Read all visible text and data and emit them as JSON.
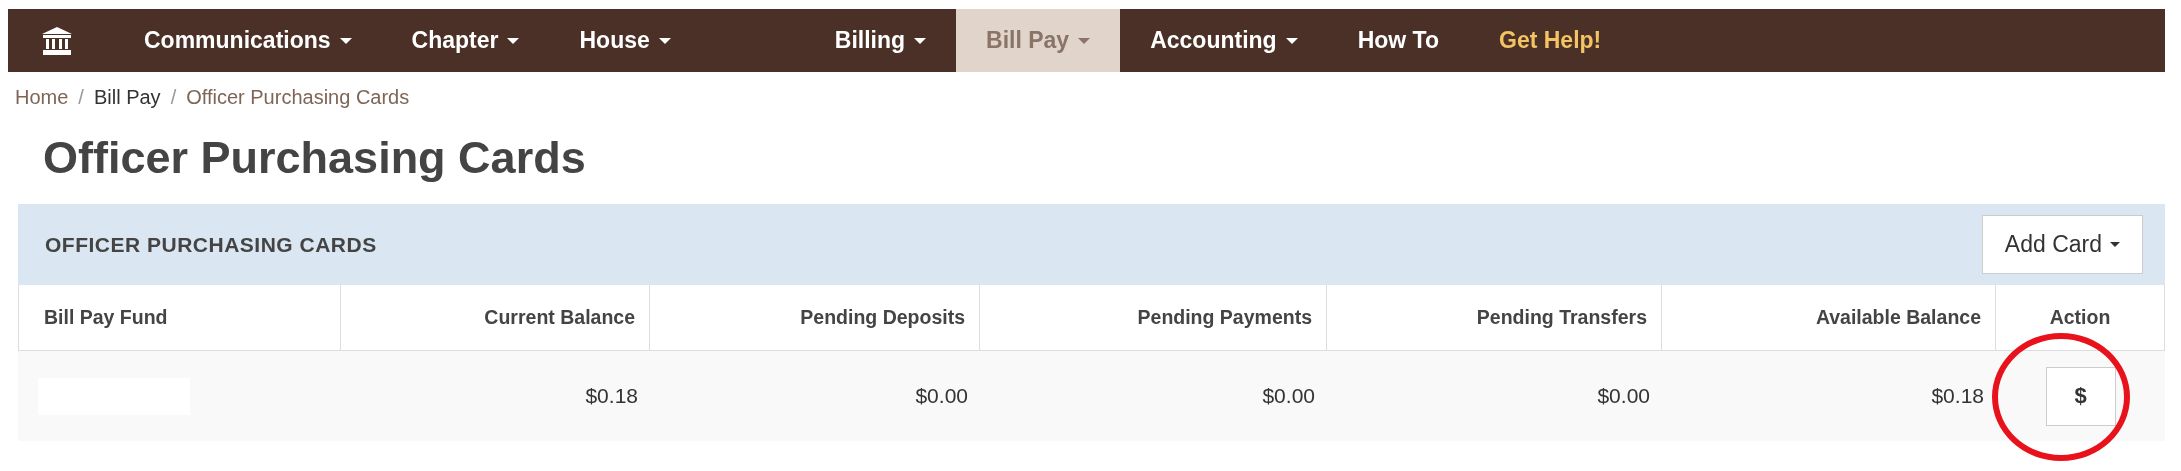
{
  "nav": {
    "items": [
      {
        "kind": "home",
        "dropdown": false,
        "selected": false
      },
      {
        "kind": "link",
        "label": "Communications",
        "dropdown": true,
        "selected": false
      },
      {
        "kind": "link",
        "label": "Chapter",
        "dropdown": true,
        "selected": false
      },
      {
        "kind": "link",
        "label": "House",
        "dropdown": true,
        "selected": false
      },
      {
        "kind": "link",
        "label": "Billing",
        "dropdown": true,
        "selected": false
      },
      {
        "kind": "link",
        "label": "Bill Pay",
        "dropdown": true,
        "selected": true
      },
      {
        "kind": "link",
        "label": "Accounting",
        "dropdown": true,
        "selected": false
      },
      {
        "kind": "link",
        "label": "How To",
        "dropdown": false,
        "selected": false
      },
      {
        "kind": "help",
        "label": "Get Help!",
        "dropdown": false,
        "selected": false
      }
    ]
  },
  "breadcrumb": [
    {
      "label": "Home",
      "kind": "link"
    },
    {
      "label": "Bill Pay",
      "kind": "plain"
    },
    {
      "label": "Officer Purchasing Cards",
      "kind": "current"
    }
  ],
  "breadcrumb_separators": [
    "/",
    "/"
  ],
  "page_title": "Officer Purchasing Cards",
  "panel": {
    "title": "OFFICER PURCHASING CARDS",
    "add_button": "Add Card",
    "table": {
      "columns": [
        "Bill Pay Fund",
        "Current Balance",
        "Pending Deposits",
        "Pending Payments",
        "Pending Transfers",
        "Available Balance",
        "Action"
      ],
      "rows": [
        {
          "fund_redacted": true,
          "values": [
            "$0.18",
            "$0.00",
            "$0.00",
            "$0.00",
            "$0.18"
          ],
          "action": "$",
          "action_circled": true
        }
      ]
    }
  }
}
